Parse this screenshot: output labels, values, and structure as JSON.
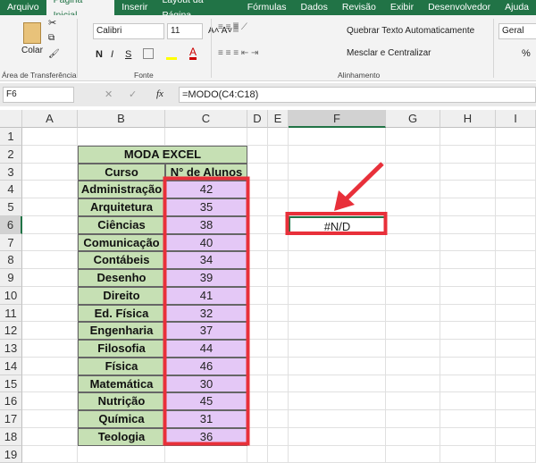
{
  "tabs": [
    "Arquivo",
    "Página Inicial",
    "Inserir",
    "Layout da Página",
    "Fórmulas",
    "Dados",
    "Revisão",
    "Exibir",
    "Desenvolvedor",
    "Ajuda"
  ],
  "ribbon": {
    "paste": "Colar",
    "clipboard_group": "Área de Transferência",
    "font_name": "Calibri",
    "font_size": "11",
    "bold": "N",
    "italic": "I",
    "underline": "S",
    "font_group": "Fonte",
    "wrap_text": "Quebrar Texto Automaticamente",
    "merge_center": "Mesclar e Centralizar",
    "alignment_group": "Alinhamento",
    "number_format": "Geral",
    "percent": "%"
  },
  "formula_bar": {
    "name_box": "F6",
    "fx": "fx",
    "formula": "=MODO(C4:C18)"
  },
  "columns": [
    "A",
    "B",
    "C",
    "D",
    "E",
    "F",
    "G",
    "H",
    "I"
  ],
  "rows": [
    "1",
    "2",
    "3",
    "4",
    "5",
    "6",
    "7",
    "8",
    "9",
    "10",
    "11",
    "12",
    "13",
    "14",
    "15",
    "16",
    "17",
    "18",
    "19"
  ],
  "table": {
    "title": "MODA EXCEL",
    "header_course": "Curso",
    "header_students": "N° de Alunos",
    "rows": [
      [
        "Administração",
        "42"
      ],
      [
        "Arquitetura",
        "35"
      ],
      [
        "Ciências",
        "38"
      ],
      [
        "Comunicação",
        "40"
      ],
      [
        "Contábeis",
        "34"
      ],
      [
        "Desenho",
        "39"
      ],
      [
        "Direito",
        "41"
      ],
      [
        "Ed. Física",
        "32"
      ],
      [
        "Engenharia",
        "37"
      ],
      [
        "Filosofia",
        "44"
      ],
      [
        "Física",
        "46"
      ],
      [
        "Matemática",
        "30"
      ],
      [
        "Nutrição",
        "45"
      ],
      [
        "Química",
        "31"
      ],
      [
        "Teologia",
        "36"
      ]
    ]
  },
  "result_cell": "#N/D",
  "highlight_color": "#e8303a"
}
